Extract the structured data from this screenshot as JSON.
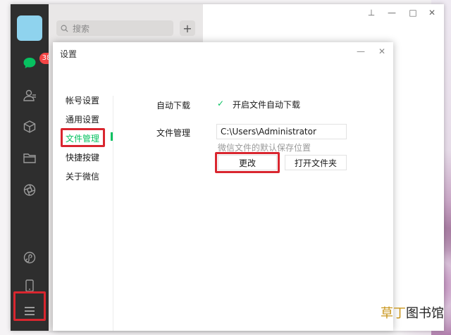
{
  "nav": {
    "badge": "38",
    "icons": [
      "chat-icon",
      "contacts-icon",
      "favorites-icon",
      "files-icon",
      "moments-icon",
      "miniprogram-icon",
      "phone-icon",
      "menu-icon"
    ]
  },
  "chat_list": {
    "search_placeholder": "搜索",
    "add_label": "+"
  },
  "window_controls": {
    "pin": "⊥",
    "minimize": "—",
    "maximize": "□",
    "close": "✕"
  },
  "dialog": {
    "title": "设置",
    "minimize": "—",
    "close": "✕",
    "sidebar": [
      {
        "label": "帐号设置",
        "active": false
      },
      {
        "label": "通用设置",
        "active": false
      },
      {
        "label": "文件管理",
        "active": true
      },
      {
        "label": "快捷按键",
        "active": false
      },
      {
        "label": "关于微信",
        "active": false
      }
    ],
    "auto_download": {
      "label": "自动下载",
      "checkbox_label": "开启文件自动下载",
      "checked": true
    },
    "file_management": {
      "label": "文件管理",
      "path": "C:\\Users\\Administrator",
      "hint": "微信文件的默认保存位置",
      "change_button": "更改",
      "open_folder_button": "打开文件夹"
    }
  },
  "watermark": {
    "accent": "草丁",
    "rest": "图书馆"
  },
  "colors": {
    "accent_green": "#07c160",
    "highlight_red": "#d9262f",
    "nav_bg": "#2e2e2e"
  }
}
